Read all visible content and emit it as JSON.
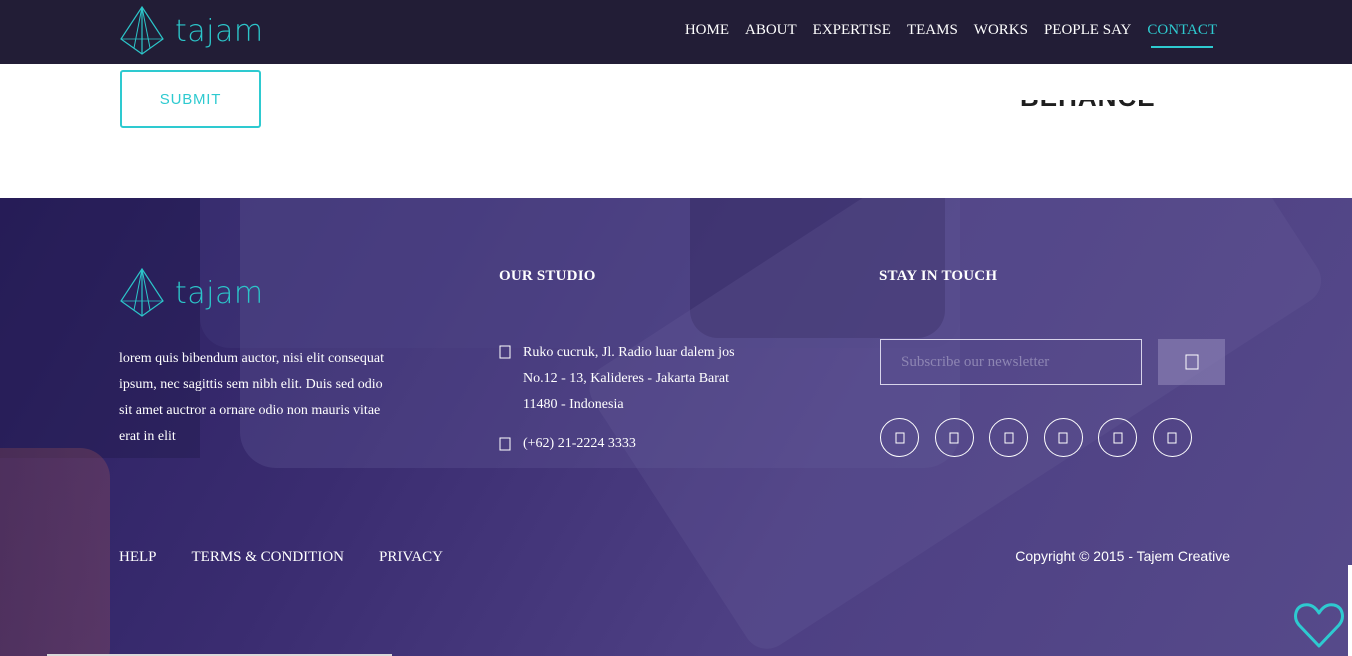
{
  "brand": {
    "name": "tajam",
    "accent_color": "#2ecad0",
    "nav_bg": "#221d36",
    "footer_bg": "#3a2c70"
  },
  "nav": {
    "items": [
      {
        "label": "HOME"
      },
      {
        "label": "ABOUT"
      },
      {
        "label": "EXPERTISE"
      },
      {
        "label": "TEAMS"
      },
      {
        "label": "WORKS"
      },
      {
        "label": "PEOPLE SAY"
      },
      {
        "label": "CONTACT",
        "active": true
      }
    ]
  },
  "contact": {
    "submit_label": "SUBMIT",
    "cropped_heading": "BEHANCE"
  },
  "footer": {
    "about_text": "lorem quis bibendum auctor, nisi elit consequat ipsum, nec sagittis sem nibh elit. Duis sed odio sit amet auctror a ornare odio non mauris vitae erat in elit",
    "studio": {
      "heading": "OUR STUDIO",
      "address": "Ruko cucruk, Jl. Radio luar dalem jos No.12 - 13, Kalideres - Jakarta Barat 11480 - Indonesia",
      "phone": "(+62) 21-2224 3333",
      "address_icon": "map-marker-icon",
      "phone_icon": "phone-icon"
    },
    "touch": {
      "heading": "STAY IN TOUCH",
      "newsletter_placeholder": "Subscribe our newsletter",
      "subscribe_icon": "paper-plane-icon",
      "socials": [
        "facebook-icon",
        "twitter-icon",
        "instagram-icon",
        "google-plus-icon",
        "pinterest-icon",
        "dribbble-icon"
      ]
    },
    "links": [
      {
        "label": "HELP"
      },
      {
        "label": "TERMS & CONDITION"
      },
      {
        "label": "PRIVACY"
      }
    ],
    "copyright": "Copyright © 2015 - Tajem Creative"
  },
  "floating": {
    "favorite_icon": "heart-icon"
  }
}
